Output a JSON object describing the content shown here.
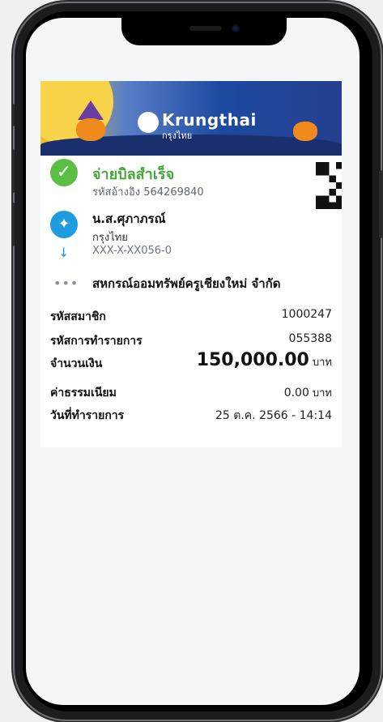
{
  "bank": {
    "name": "Krungthai",
    "sub_name": "กรุงไทย"
  },
  "status": {
    "title": "จ่ายบิลสำเร็จ",
    "ref": "รหัสอ้างอิง 564269840"
  },
  "payer": {
    "name": "น.ส.ศุภาภรณ์",
    "bank": "กรุงไทย",
    "account": "XXX-X-XX056-0"
  },
  "payee": {
    "name": "สหกรณ์ออมทรัพย์ครูเชียงใหม่ จำกัด"
  },
  "details": {
    "member_label": "รหัสสมาชิก",
    "member_value": "1000247",
    "txn_label": "รหัสการทำรายการ",
    "txn_value": "055388",
    "amount_label": "จำนวนเงิน",
    "amount_value": "150,000.00",
    "amount_unit": "บาท",
    "fee_label": "ค่าธรรมเนียม",
    "fee_value": "0.00",
    "fee_unit": "บาท",
    "date_label": "วันที่ทำรายการ",
    "date_value": "25 ต.ค. 2566 - 14:14"
  },
  "colors": {
    "success": "#46a83a",
    "brand_blue": "#1f9be0"
  }
}
